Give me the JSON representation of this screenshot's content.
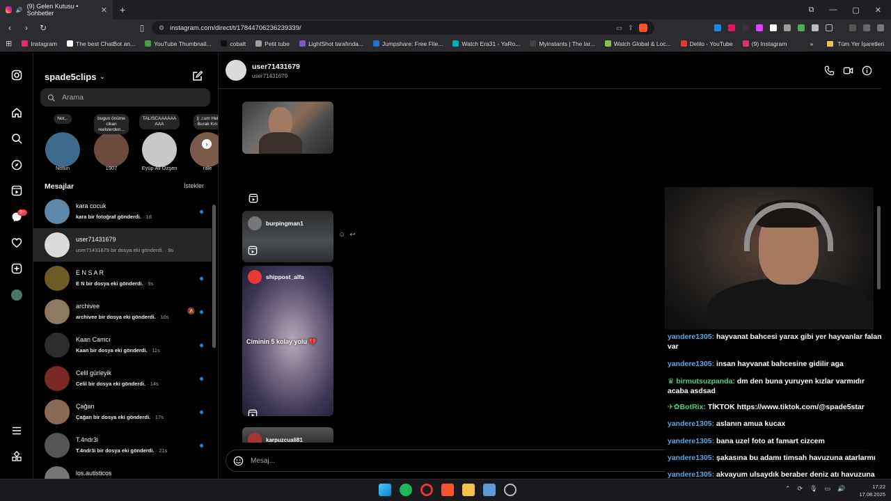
{
  "browser": {
    "tab_title": "(9) Gelen Kutusu • Sohbetler",
    "tab_close": "✕",
    "new_tab": "+",
    "url": "instagram.com/direct/t/17844706236239339/",
    "bookmarks": [
      {
        "label": "Instagram",
        "color": "#e1306c"
      },
      {
        "label": "The best ChatBot an...",
        "color": "#ffffff"
      },
      {
        "label": "YouTube Thumbnail...",
        "color": "#43a047"
      },
      {
        "label": "cobalt",
        "color": "#111111"
      },
      {
        "label": "Petit tube",
        "color": "#9e9e9e"
      },
      {
        "label": "LightShot tarafında...",
        "color": "#7e57c2"
      },
      {
        "label": "Jumpshare: Free File...",
        "color": "#1976d2"
      },
      {
        "label": "Watch Era31 - YaRo...",
        "color": "#00acc1"
      },
      {
        "label": "Myinstants | The lar...",
        "color": "#424242"
      },
      {
        "label": "Watch Global & Loc...",
        "color": "#8bc34a"
      },
      {
        "label": "Delilo - YouTube",
        "color": "#e53935"
      },
      {
        "label": "(9) Instagram",
        "color": "#e1306c"
      }
    ],
    "all_bookmarks": "Tüm Yer İşaretleri"
  },
  "inbox": {
    "username": "spade5clips",
    "search_placeholder": "Arama",
    "notes": [
      {
        "bubble": "Not...",
        "name": "Notun",
        "color": "#3d6b8c"
      },
      {
        "bubble": "bugun önüme\ncikan\nreelslerden...",
        "name": "1907",
        "color": "#6b4b3e"
      },
      {
        "bubble": "TALISCAAAAAA\nAAA",
        "name": "Eyüp Ali Özşen",
        "color": "#c8c8c8"
      },
      {
        "bubble": "|| ♫um Hel\nBurak Kırı",
        "name": "rale",
        "color": "#7a5b4a"
      }
    ],
    "messages_title": "Mesajlar",
    "requests_label": "İstekler",
    "rail_badge": "9+",
    "conversations": [
      {
        "name": "kara cocuk",
        "preview": "kara bir fotoğraf gönderdi.",
        "time": " · 1d",
        "unread": true,
        "muted": false,
        "color": "#5f87a8"
      },
      {
        "name": "user71431679",
        "preview": "user71431679 bir dosya eki gönderdi.",
        "time": " · 9s",
        "unread": false,
        "muted": false,
        "color": "#dbdbdb"
      },
      {
        "name": "E N S A R",
        "preview": "E N bir dosya eki gönderdi.",
        "time": " · 9s",
        "unread": true,
        "muted": false,
        "color": "#6b5a22"
      },
      {
        "name": "archivee",
        "preview": "archivee bir dosya eki gönderdi.",
        "time": " · 10s",
        "unread": true,
        "muted": true,
        "color": "#8d7a62"
      },
      {
        "name": "Kaan Camcı",
        "preview": "Kaan bir dosya eki gönderdi.",
        "time": " · 11s",
        "unread": true,
        "muted": false,
        "color": "#2c2c2c"
      },
      {
        "name": "Celil gürleyik",
        "preview": "Celil bir dosya eki gönderdi.",
        "time": " · 14s",
        "unread": true,
        "muted": false,
        "color": "#7a2a22"
      },
      {
        "name": "Çağan",
        "preview": "Çağan bir dosya eki gönderdi.",
        "time": " · 17s",
        "unread": true,
        "muted": false,
        "color": "#8a6a55"
      },
      {
        "name": "T.4ndr3i",
        "preview": "T.4ndr3i bir dosya eki gönderdi.",
        "time": " · 21s",
        "unread": true,
        "muted": false,
        "color": "#555555"
      },
      {
        "name": "los.autisticos",
        "preview": "",
        "time": "",
        "unread": false,
        "muted": false,
        "color": "#777777"
      }
    ]
  },
  "thread": {
    "name": "user71431679",
    "username": "user71431679",
    "reel1_author": "burpingman1",
    "reel2_author": "shippost_alfa",
    "reel2_caption": "Ciminin 5 kolay yolu 💔",
    "reel3_author": "karpuzcuali81",
    "composer_placeholder": "Mesaj..."
  },
  "stream_chat": [
    {
      "user": "yandere1305:",
      "text": " hayvanat bahcesi yarax gibi yer hayvanlar falan var",
      "color": "#5aa9e6"
    },
    {
      "user": "yandere1305:",
      "text": " insan hayvanat bahcesine gidilir aga",
      "color": "#5aa9e6"
    },
    {
      "user": "♛ birmutsuzpanda:",
      "text": " dm den buna yuruyen kızlar varmıdır acaba asdsad",
      "color": "#4fd37d"
    },
    {
      "user": "✈✿BotRix:",
      "text": " TİKTOK https://www.tiktok.com/@spade5star",
      "color": "#4fd37d"
    },
    {
      "user": "yandere1305:",
      "text": " aslanın amua kucax",
      "color": "#5aa9e6"
    },
    {
      "user": "yandere1305:",
      "text": " bana uzel foto at famart cizcem",
      "color": "#5aa9e6"
    },
    {
      "user": "yandere1305:",
      "text": " şakasına bu adamı timsah havuzuna atarlarmı",
      "color": "#5aa9e6"
    },
    {
      "user": "yandere1305:",
      "text": " akvayum ulsaydık beraber deniz atı havuzuna işermiydik",
      "color": "#5aa9e6"
    }
  ],
  "taskbar": {
    "time": "17:22",
    "date": "17.08.2025"
  }
}
